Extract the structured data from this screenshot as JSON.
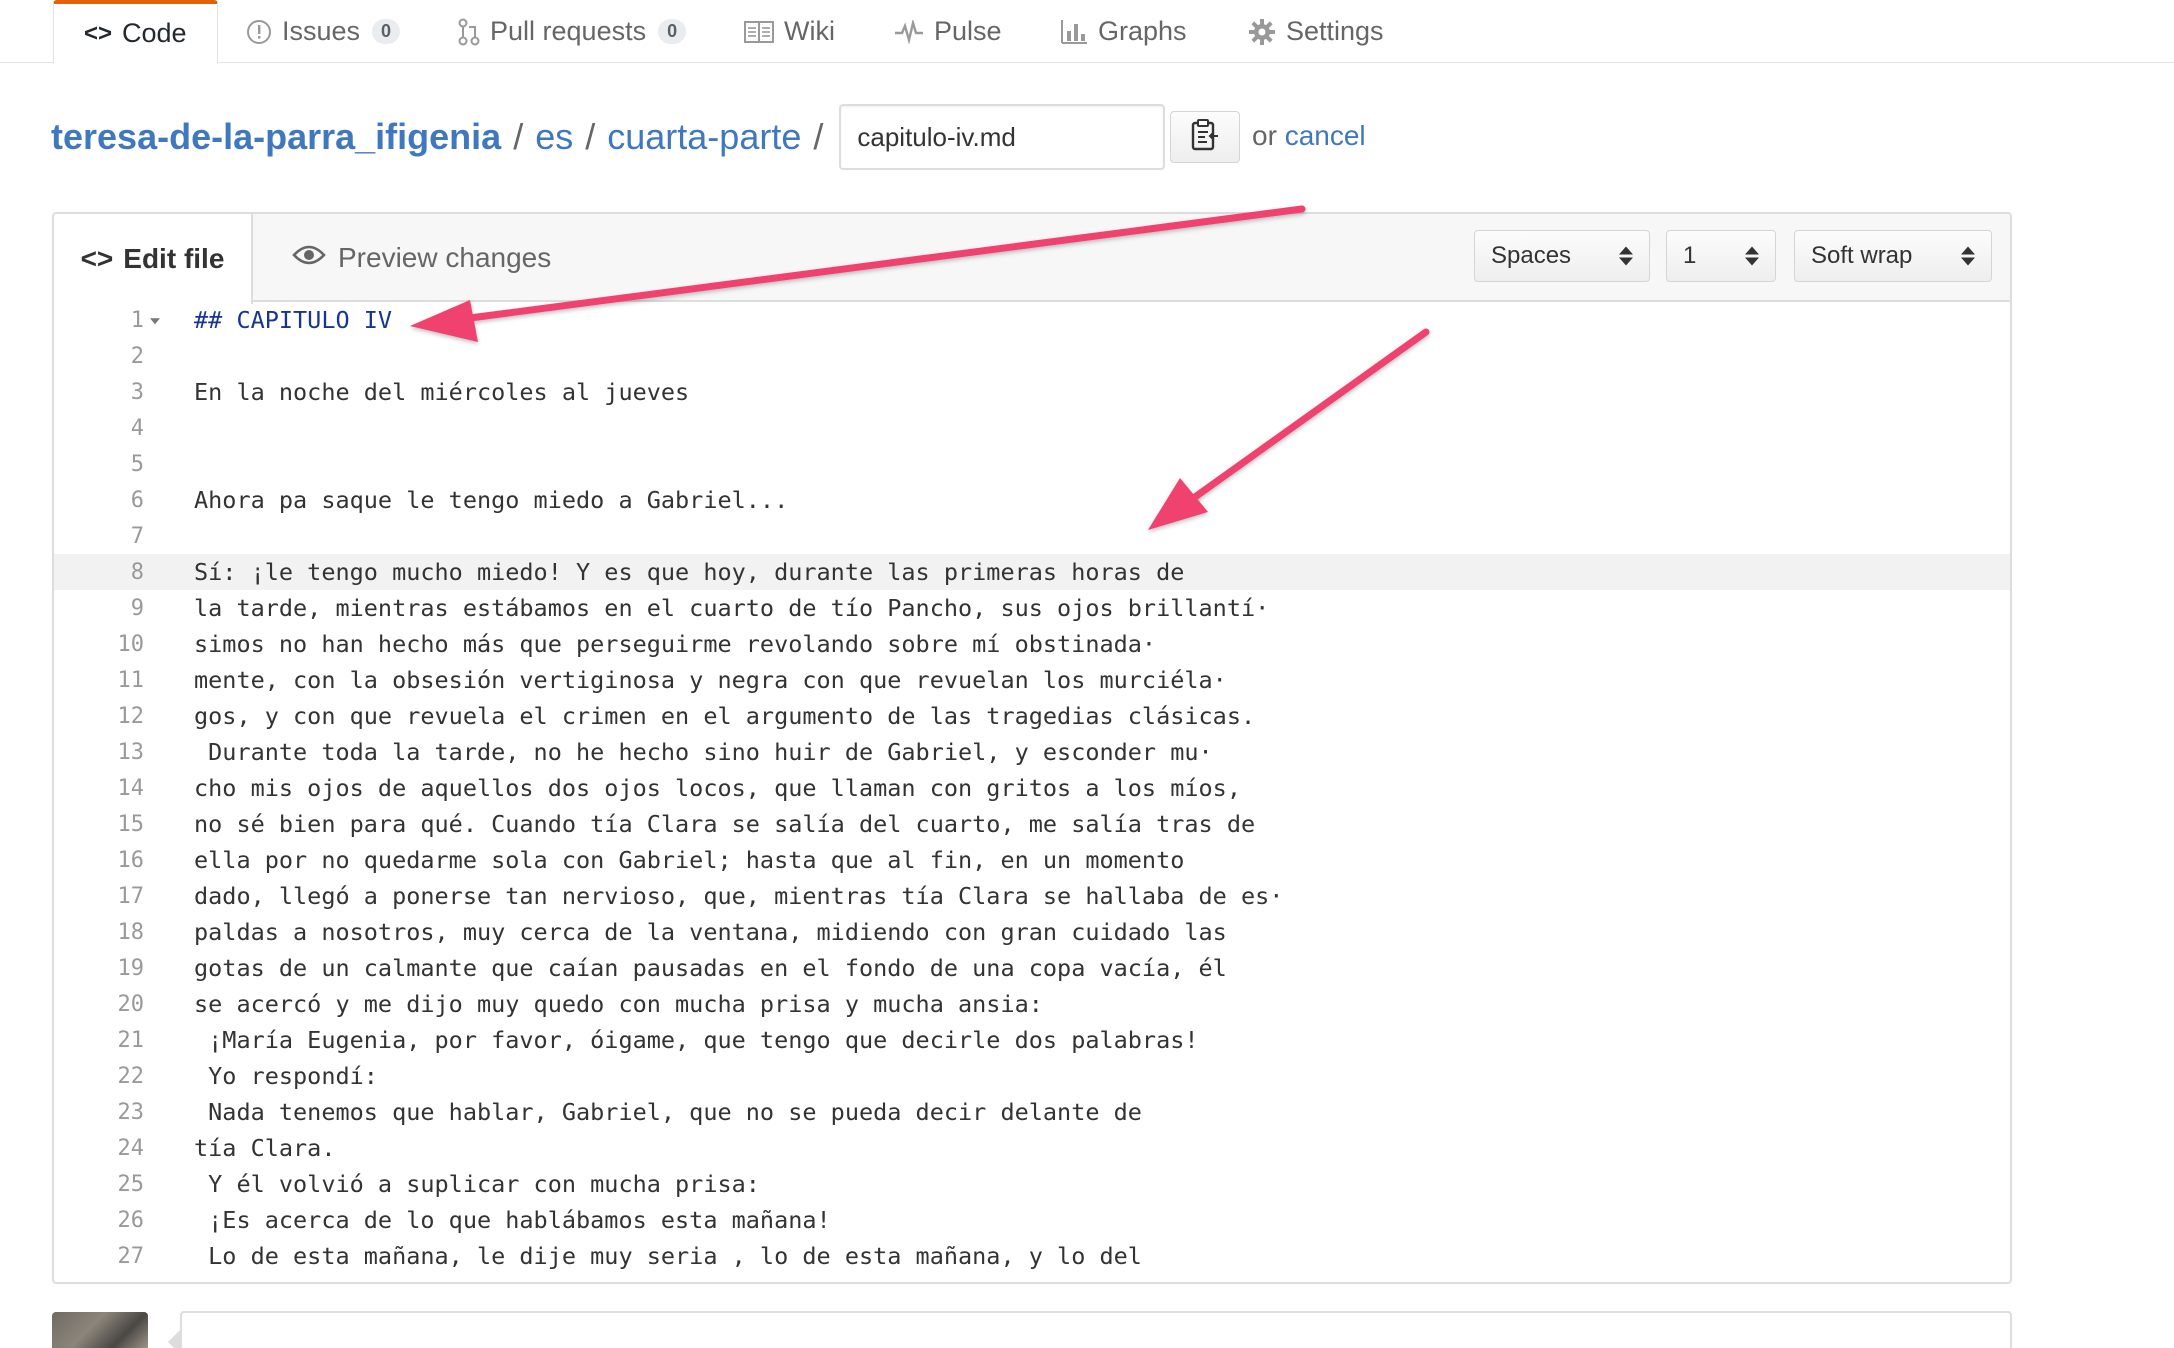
{
  "repo_nav": {
    "tabs": [
      {
        "label": "Code",
        "icon": "code-icon",
        "active": true
      },
      {
        "label": "Issues",
        "icon": "issue-icon",
        "count": "0"
      },
      {
        "label": "Pull requests",
        "icon": "pull-request-icon",
        "count": "0"
      },
      {
        "label": "Wiki",
        "icon": "book-icon"
      },
      {
        "label": "Pulse",
        "icon": "pulse-icon"
      },
      {
        "label": "Graphs",
        "icon": "graph-icon"
      },
      {
        "label": "Settings",
        "icon": "gear-icon"
      }
    ]
  },
  "breadcrumb": {
    "repo": "teresa-de-la-parra_ifigenia",
    "sep": "/",
    "folders": [
      "es",
      "cuarta-parte"
    ],
    "filename_value": "capitulo-iv.md",
    "or_text": "or",
    "cancel_label": "cancel"
  },
  "editor": {
    "edit_tab_label": "Edit file",
    "preview_tab_label": "Preview changes",
    "indent_mode": "Spaces",
    "indent_size": "1",
    "wrap_mode": "Soft wrap",
    "highlighted_line": 8,
    "lines": [
      "## CAPITULO IV",
      "",
      "En la noche del miércoles al jueves",
      "",
      "",
      "Ahora pa saque le tengo miedo a Gabriel...",
      "",
      "Sí: ¡le tengo mucho miedo! Y es que hoy, durante las primeras horas de",
      "la tarde, mientras estábamos en el cuarto de tío Pancho, sus ojos brillantí·",
      "simos no han hecho más que perseguirme revolando sobre mí obstinada·",
      "mente, con la obsesión vertiginosa y negra con que revuelan los murciéla·",
      "gos, y con que revuela el crimen en el argumento de las tragedias clásicas.",
      " Durante toda la tarde, no he hecho sino huir de Gabriel, y esconder mu·",
      "cho mis ojos de aquellos dos ojos locos, que llaman con gritos a los míos,",
      "no sé bien para qué. Cuando tía Clara se salía del cuarto, me salía tras de",
      "ella por no quedarme sola con Gabriel; hasta que al fin, en un momento",
      "dado, llegó a ponerse tan nervioso, que, mientras tía Clara se hallaba de es·",
      "paldas a nosotros, muy cerca de la ventana, midiendo con gran cuidado las",
      "gotas de un calmante que caían pausadas en el fondo de una copa vacía, él",
      "se acercó y me dijo muy quedo con mucha prisa y mucha ansia:",
      " ¡María Eugenia, por favor, óigame, que tengo que decirle dos palabras!",
      " Yo respondí:",
      " Nada tenemos que hablar, Gabriel, que no se pueda decir delante de",
      "tía Clara.",
      " Y él volvió a suplicar con mucha prisa:",
      " ¡Es acerca de lo que hablábamos esta mañana!",
      " Lo de esta mañana, le dije muy seria , lo de esta mañana, y lo del"
    ]
  },
  "colors": {
    "link": "#4078c0",
    "heading_markdown": "#183691",
    "annotation_arrow": "#f0426e",
    "active_tab_border": "#e36209"
  }
}
